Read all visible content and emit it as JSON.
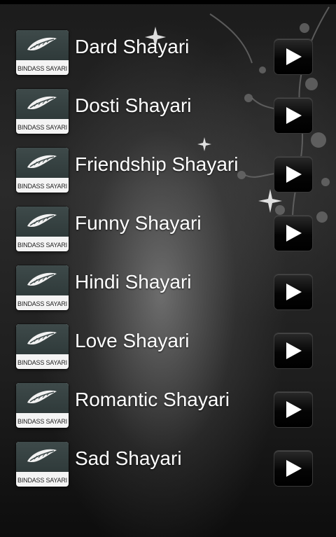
{
  "items": [
    {
      "title": "Dard Shayari",
      "thumb_label": "BINDASS SAYARI",
      "thumb_icon": "feather-pen-icon",
      "action_icon": "play-icon"
    },
    {
      "title": "Dosti Shayari",
      "thumb_label": "BINDASS SAYARI",
      "thumb_icon": "feather-pen-icon",
      "action_icon": "play-icon"
    },
    {
      "title": "Friendship Shayari",
      "thumb_label": "BINDASS SAYARI",
      "thumb_icon": "feather-pen-icon",
      "action_icon": "play-icon"
    },
    {
      "title": "Funny Shayari",
      "thumb_label": "BINDASS SAYARI",
      "thumb_icon": "feather-pen-icon",
      "action_icon": "play-icon"
    },
    {
      "title": "Hindi Shayari",
      "thumb_label": "BINDASS SAYARI",
      "thumb_icon": "feather-pen-icon",
      "action_icon": "play-icon"
    },
    {
      "title": "Love Shayari",
      "thumb_label": "BINDASS SAYARI",
      "thumb_icon": "feather-pen-icon",
      "action_icon": "play-icon"
    },
    {
      "title": "Romantic Shayari",
      "thumb_label": "BINDASS SAYARI",
      "thumb_icon": "feather-pen-icon",
      "action_icon": "play-icon"
    },
    {
      "title": "Sad Shayari",
      "thumb_label": "BINDASS SAYARI",
      "thumb_icon": "feather-pen-icon",
      "action_icon": "play-icon"
    }
  ],
  "colors": {
    "text": "#ffffff",
    "background": "#1e1e1e",
    "thumb_top": "#3e4a4a",
    "button": "#000000"
  }
}
